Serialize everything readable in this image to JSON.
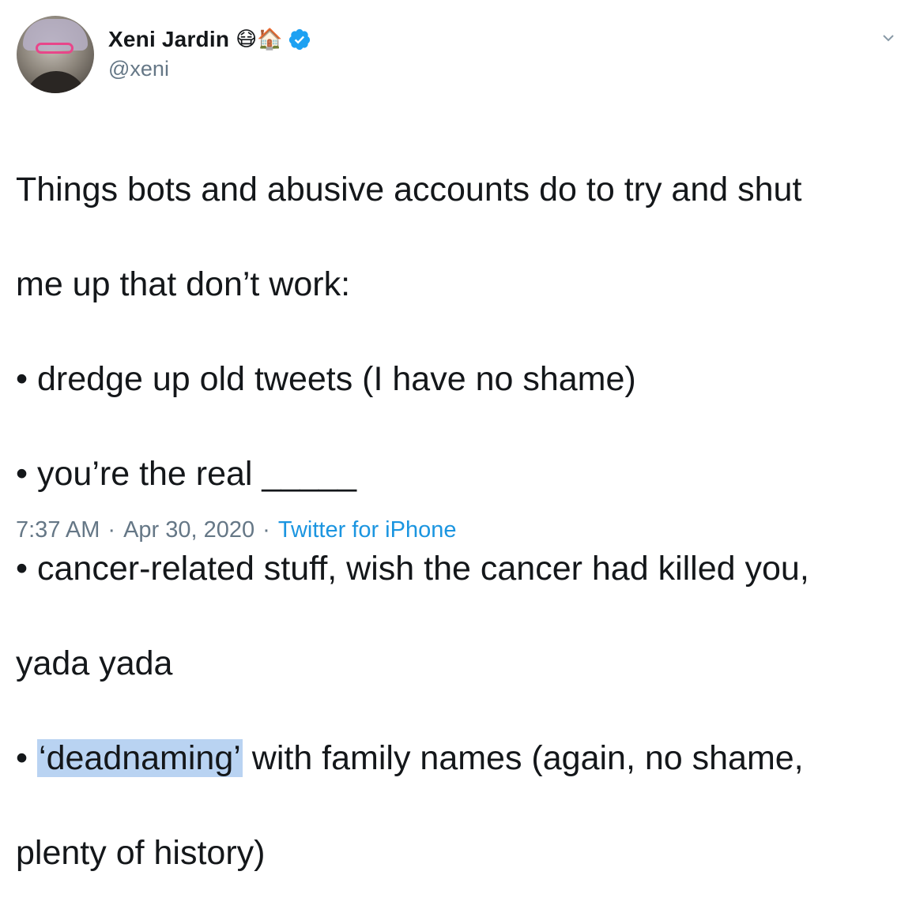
{
  "author": {
    "display_name": "Xeni Jardin",
    "emojis": "😷🏠",
    "handle": "@xeni",
    "verified": true
  },
  "tweet": {
    "lines": [
      "Things bots and abusive accounts do to try and shut",
      "me up that don’t work:",
      "• dredge up old tweets (I have no shame)",
      "• you’re the real _____",
      "• cancer-related stuff, wish the cancer had killed you,",
      "yada yada"
    ],
    "last_bullet_prefix": "• ",
    "highlighted_word": "‘deadnaming’",
    "last_bullet_rest": " with family names (again, no shame,",
    "final_line": "plenty of history)"
  },
  "meta": {
    "time": "7:37 AM",
    "date": "Apr 30, 2020",
    "source": "Twitter for iPhone",
    "separator": "·"
  },
  "colors": {
    "text": "#14171a",
    "secondary": "#657786",
    "link": "#1b95e0",
    "verified": "#1da1f2",
    "highlight": "#b9d3f2"
  },
  "icons": {
    "verified": "verified-badge-icon",
    "menu": "chevron-down-icon"
  }
}
